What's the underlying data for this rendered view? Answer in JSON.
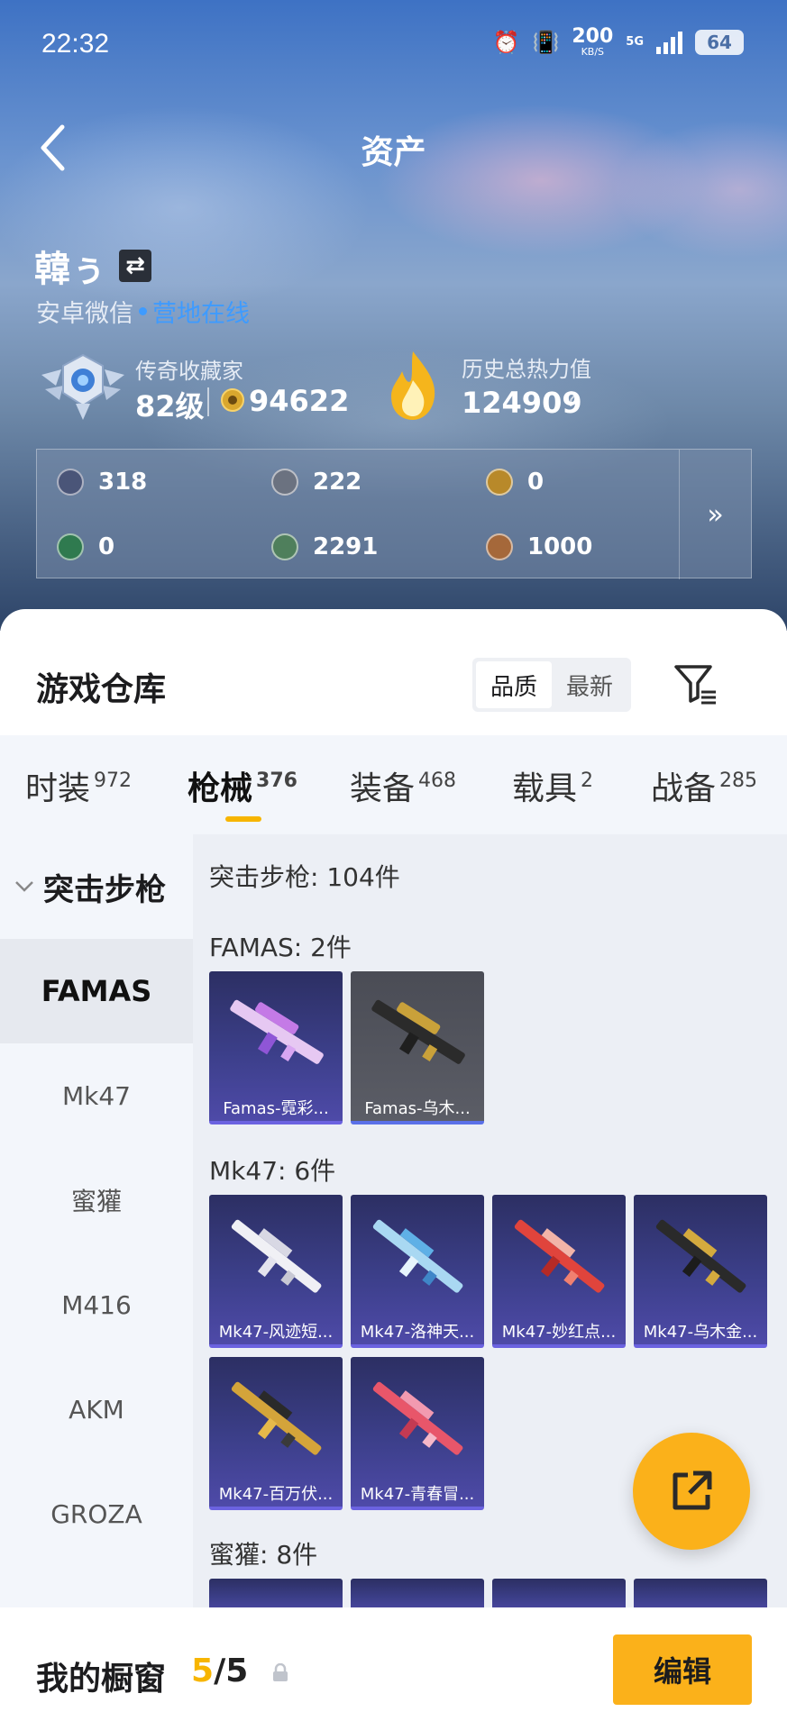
{
  "status_bar": {
    "time": "22:32",
    "speed_value": "200",
    "speed_unit": "KB/S",
    "network": "5G",
    "battery": "64"
  },
  "header": {
    "title": "资产"
  },
  "profile": {
    "name": "韓ぅ",
    "platform": "安卓微信",
    "online_status": "营地在线",
    "rank_title": "传奇收藏家",
    "rank_level": "82级",
    "coin_value": "94622",
    "heat_title": "历史总热力值",
    "heat_value": "124909",
    "help_glyph": "?"
  },
  "assets": [
    {
      "icon": "card-icon",
      "value": "318",
      "color": "#4a5578"
    },
    {
      "icon": "silver-coin-icon",
      "value": "222",
      "color": "#6b7280"
    },
    {
      "icon": "gold-token-icon",
      "value": "0",
      "color": "#b8892a"
    },
    {
      "icon": "green-card-icon",
      "value": "0",
      "color": "#2f7a4f"
    },
    {
      "icon": "green-gem-icon",
      "value": "2291",
      "color": "#4f7f5c"
    },
    {
      "icon": "bronze-coin-icon",
      "value": "1000",
      "color": "#a5683a"
    }
  ],
  "asset_more": "»",
  "warehouse": {
    "title": "游戏仓库",
    "sort_options": [
      "品质",
      "最新"
    ],
    "sort_active": "品质"
  },
  "tabs": [
    {
      "label": "时装",
      "count": "972"
    },
    {
      "label": "枪械",
      "count": "376"
    },
    {
      "label": "装备",
      "count": "468"
    },
    {
      "label": "载具",
      "count": "2"
    },
    {
      "label": "战备",
      "count": "285"
    }
  ],
  "categories": {
    "head": "突击步枪",
    "items": [
      "FAMAS",
      "Mk47",
      "蜜獾",
      "M416",
      "AKM",
      "GROZA"
    ],
    "active": "FAMAS"
  },
  "inventory": {
    "total": "突击步枪: 104件",
    "groups": [
      {
        "title": "FAMAS: 2件",
        "items": [
          "Famas-霓彩...",
          "Famas-乌木..."
        ]
      },
      {
        "title": "Mk47: 6件",
        "items": [
          "Mk47-风迹短...",
          "Mk47-洛神天...",
          "Mk47-妙红点...",
          "Mk47-乌木金...",
          "Mk47-百万伏...",
          "Mk47-青春冒..."
        ]
      },
      {
        "title": "蜜獾: 8件"
      }
    ]
  },
  "bottom_bar": {
    "label": "我的橱窗",
    "count_current": "5",
    "count_total": "/5",
    "edit_label": "编辑"
  }
}
